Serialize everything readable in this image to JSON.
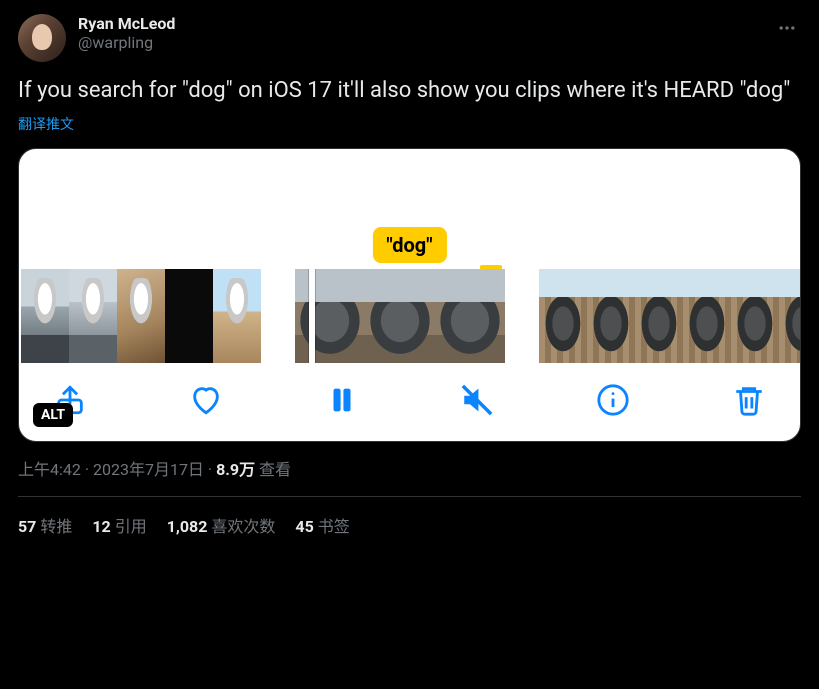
{
  "user": {
    "display_name": "Ryan McLeod",
    "handle": "@warpling"
  },
  "body_text": "If you search for \"dog\" on iOS 17 it'll also show you clips where it's HEARD \"dog\"",
  "translate_label": "翻译推文",
  "media": {
    "search_tag": "\"dog\"",
    "alt_badge": "ALT"
  },
  "meta": {
    "time": "上午4:42",
    "date": "2023年7月17日",
    "views_count": "8.9万",
    "views_label": "查看"
  },
  "stats": {
    "retweets_count": "57",
    "retweets_label": "转推",
    "quotes_count": "12",
    "quotes_label": "引用",
    "likes_count": "1,082",
    "likes_label": "喜欢次数",
    "bookmarks_count": "45",
    "bookmarks_label": "书签"
  }
}
